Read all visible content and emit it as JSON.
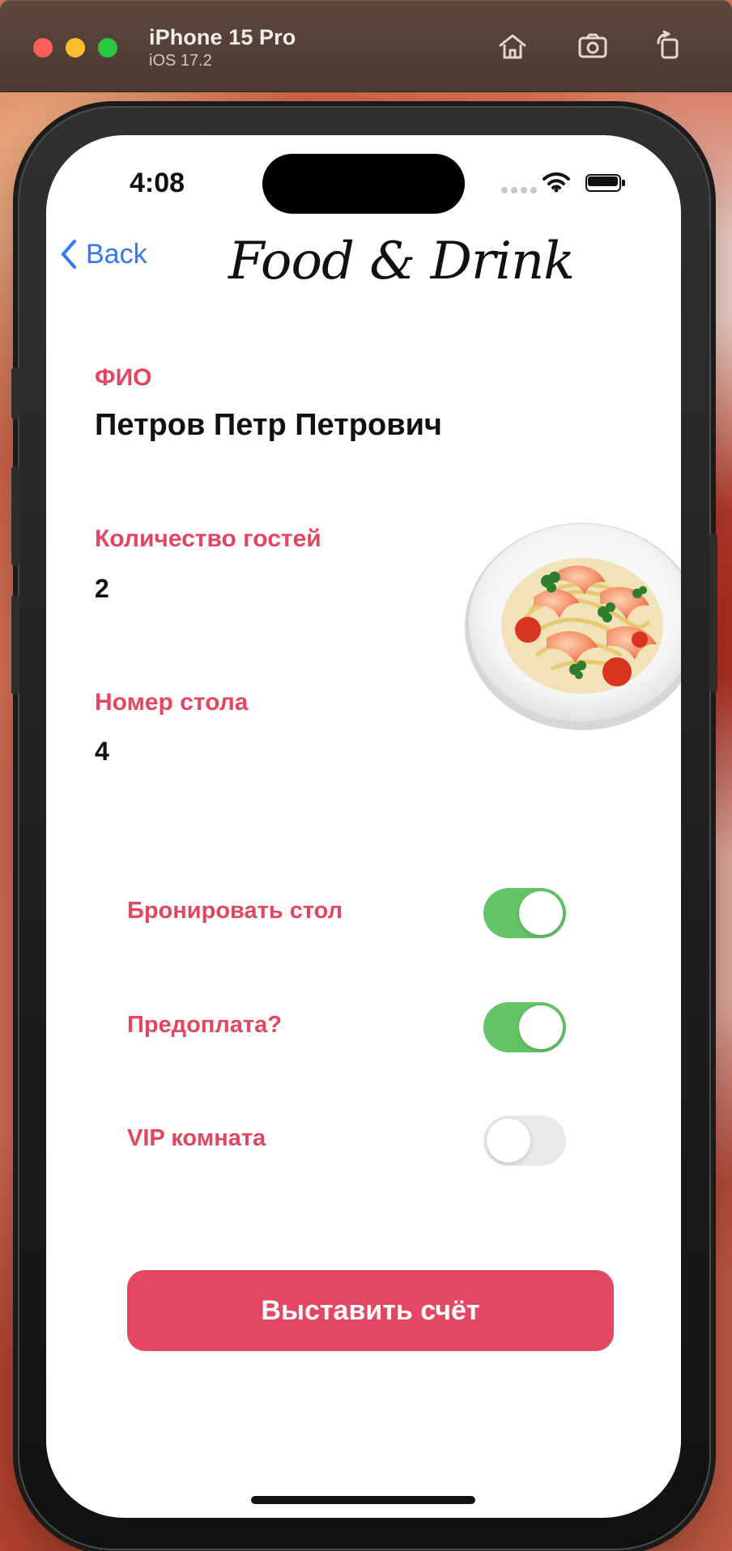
{
  "window": {
    "device_name": "iPhone 15 Pro",
    "os_version": "iOS 17.2"
  },
  "status_bar": {
    "time": "4:08"
  },
  "nav": {
    "back_label": "Back",
    "brand_title": "Food & Drink"
  },
  "fields": {
    "fio_label": "ФИО",
    "fio_value": "Петров Петр Петрович",
    "guests_label": "Количество гостей",
    "guests_value": "2",
    "table_label": "Номер стола",
    "table_value": "4"
  },
  "toggles": {
    "book_table": {
      "label": "Бронировать стол",
      "on": true
    },
    "prepayment": {
      "label": "Предоплата?",
      "on": true
    },
    "vip_room": {
      "label": "VIP комната",
      "on": false
    }
  },
  "actions": {
    "invoice_button": "Выставить счёт"
  },
  "icons": {
    "home": "home-icon",
    "screenshot": "camera-icon",
    "rotate": "rotate-icon",
    "wifi": "wifi-icon",
    "battery": "battery-icon",
    "back": "chevron-left-icon"
  },
  "colors": {
    "accent_red": "#e24660",
    "button_red": "#e34863",
    "ios_blue": "#3478f6",
    "toggle_green": "#63c466",
    "toggle_off": "#e9e9eb"
  }
}
